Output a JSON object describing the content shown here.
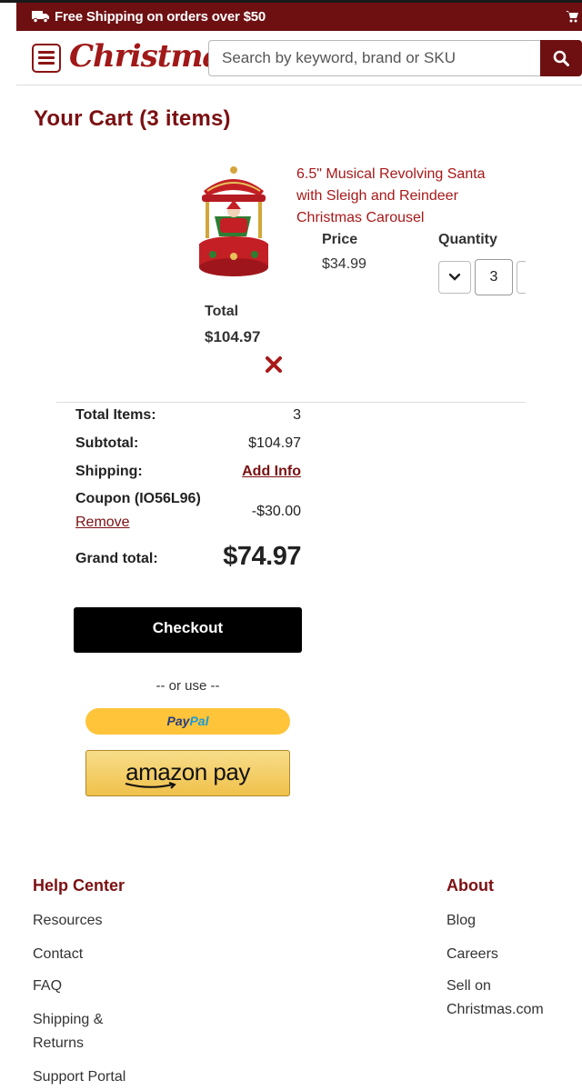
{
  "promo": {
    "text": "Free Shipping on orders over $50"
  },
  "header": {
    "logo": "Christmas",
    "search_placeholder": "Search by keyword, brand or SKU"
  },
  "cart": {
    "title": "Your Cart (3 items)",
    "item": {
      "name": "6.5\" Musical Revolving Santa with Sleigh and Reindeer Christmas Carousel",
      "price_label": "Price",
      "price": "$34.99",
      "quantity_label": "Quantity",
      "quantity": "3",
      "total_label": "Total",
      "total": "$104.97"
    }
  },
  "summary": {
    "total_items_label": "Total Items:",
    "total_items": "3",
    "subtotal_label": "Subtotal:",
    "subtotal": "$104.97",
    "shipping_label": "Shipping:",
    "shipping_action": "Add Info",
    "coupon_label": "Coupon (IO56L96)",
    "coupon_remove": "Remove",
    "coupon_amount": "-$30.00",
    "grand_total_label": "Grand total:",
    "grand_total": "$74.97"
  },
  "payment": {
    "checkout": "Checkout",
    "or_use": "-- or use --",
    "paypal_part1": "Pay",
    "paypal_part2": "Pal",
    "amazon": "amazon pay"
  },
  "footer": {
    "help_title": "Help Center",
    "help_links": [
      "Resources",
      "Contact",
      "FAQ",
      "Shipping &",
      "Returns",
      "Support Portal"
    ],
    "about_title": "About",
    "about_links": [
      "Blog",
      "Careers",
      "Sell on",
      "Christmas.com"
    ]
  },
  "colors": {
    "brand": "#6e1012",
    "accent": "#a81919",
    "paypal": "#ffc439",
    "amazon": "#f0c14b"
  }
}
